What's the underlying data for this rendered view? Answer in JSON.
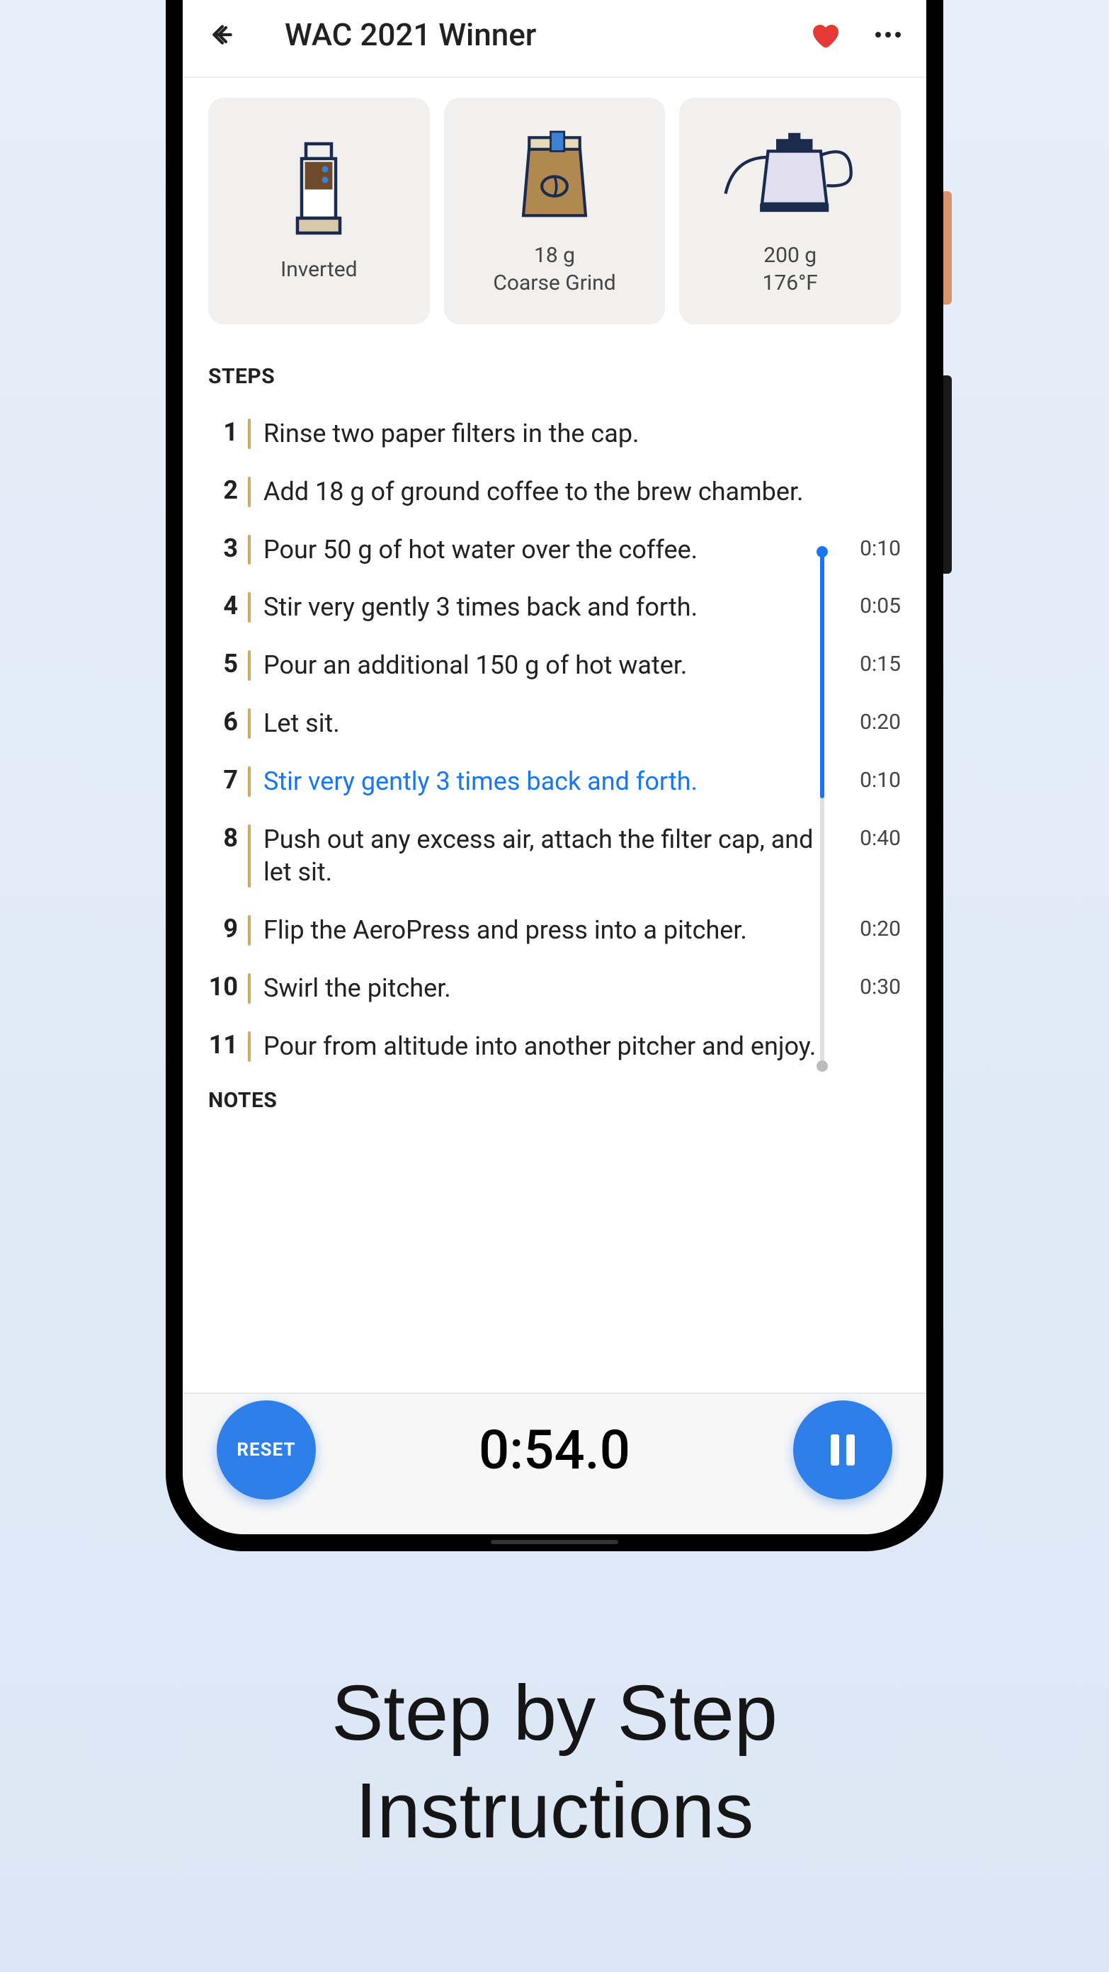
{
  "header": {
    "title": "WAC 2021 Winner"
  },
  "params": {
    "method": {
      "label": "Inverted"
    },
    "coffee": {
      "line1": "18 g",
      "line2": "Coarse Grind"
    },
    "water": {
      "line1": "200 g",
      "line2": "176°F"
    }
  },
  "sections": {
    "steps_label": "STEPS",
    "notes_label": "NOTES"
  },
  "steps": [
    {
      "num": "1",
      "text": "Rinse two paper filters in the cap.",
      "time": ""
    },
    {
      "num": "2",
      "text": "Add 18 g of ground coffee to the brew chamber.",
      "time": ""
    },
    {
      "num": "3",
      "text": "Pour 50 g of hot water over the coffee.",
      "time": "0:10"
    },
    {
      "num": "4",
      "text": "Stir very gently 3 times back and forth.",
      "time": "0:05"
    },
    {
      "num": "5",
      "text": "Pour an additional 150 g of hot water.",
      "time": "0:15"
    },
    {
      "num": "6",
      "text": "Let sit.",
      "time": "0:20"
    },
    {
      "num": "7",
      "text": "Stir very gently 3 times back and forth.",
      "time": "0:10",
      "active": true
    },
    {
      "num": "8",
      "text": "Push out any excess air, attach the filter cap, and let sit.",
      "time": "0:40"
    },
    {
      "num": "9",
      "text": "Flip the AeroPress and press into a pitcher.",
      "time": "0:20"
    },
    {
      "num": "10",
      "text": "Swirl the pitcher.",
      "time": "0:30"
    },
    {
      "num": "11",
      "text": "Pour from altitude into another pitcher and enjoy.",
      "time": ""
    }
  ],
  "timer": {
    "reset_label": "RESET",
    "display": "0:54.0"
  },
  "promo": {
    "line1": "Step by Step",
    "line2": "Instructions"
  },
  "colors": {
    "accent": "#2f7fea",
    "heart": "#e53935",
    "step_divider": "#d4a862"
  }
}
